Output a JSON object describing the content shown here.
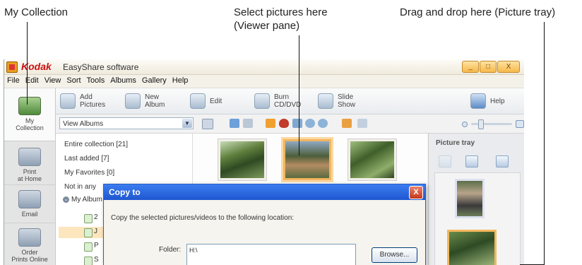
{
  "callouts": {
    "my_collection": "My Collection",
    "viewer_line1": "Select pictures here",
    "viewer_line2": "(Viewer pane)",
    "tray": "Drag and drop here (Picture tray)"
  },
  "window": {
    "brand": "Kodak",
    "title": "EasyShare software",
    "buttons": [
      "_",
      "□",
      "X"
    ]
  },
  "menu": [
    "File",
    "Edit",
    "View",
    "Sort",
    "Tools",
    "Albums",
    "Gallery",
    "Help"
  ],
  "nav": {
    "my_collection": "My Collection",
    "print_line1": "Print",
    "print_line2": "at Home",
    "email": "Email",
    "order_line1": "Order",
    "order_line2": "Prints Online"
  },
  "toolbar": {
    "add_l1": "Add",
    "add_l2": "Pictures",
    "new_l1": "New",
    "new_l2": "Album",
    "edit": "Edit",
    "burn_l1": "Burn",
    "burn_l2": "CD/DVD",
    "slide_l1": "Slide",
    "slide_l2": "Show",
    "help": "Help"
  },
  "view_select": {
    "value": "View Albums",
    "arrow": "▼"
  },
  "albums": {
    "entire": "Entire collection [21]",
    "last_added": "Last added [7]",
    "favorites": "My Favorites [0]",
    "not_in_any": "Not in any",
    "my_albums": "My Album",
    "subitems": [
      "2",
      "J",
      "P",
      "S"
    ]
  },
  "tray": {
    "title": "Picture tray"
  },
  "dialog": {
    "title": "Copy to",
    "close": "X",
    "message": "Copy the selected pictures/videos to the following location:",
    "folder_label": "Folder:",
    "folder_value": "H:\\",
    "browse": "Browse..."
  },
  "colors": {
    "accent": "#f2b560",
    "dialog_title": "#2a66dc",
    "brand": "#cc1010"
  }
}
